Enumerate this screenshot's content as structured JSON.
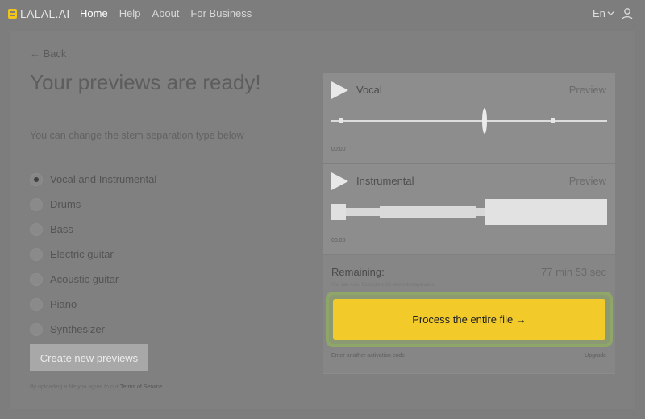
{
  "app": {
    "logo_text": "LALAL.AI"
  },
  "nav": {
    "items": [
      {
        "label": "Home",
        "active": true
      },
      {
        "label": "Help",
        "active": false
      },
      {
        "label": "About",
        "active": false
      },
      {
        "label": "For Business",
        "active": false
      }
    ],
    "language": "En"
  },
  "left": {
    "back_label": "← Back",
    "title": "Your previews are ready!",
    "subtitle": "You can change the stem separation type below",
    "options": [
      {
        "label": "Vocal and Instrumental",
        "checked": true
      },
      {
        "label": "Drums",
        "checked": false
      },
      {
        "label": "Bass",
        "checked": false
      },
      {
        "label": "Electric guitar",
        "checked": false
      },
      {
        "label": "Acoustic guitar",
        "checked": false
      },
      {
        "label": "Piano",
        "checked": false
      },
      {
        "label": "Synthesizer",
        "checked": false
      }
    ],
    "create_button": "Create new previews",
    "tos_prefix": "By uploading a file you agree to our",
    "tos_link": "Terms of Service"
  },
  "tracks": [
    {
      "name": "Vocal",
      "preview_label": "Preview",
      "time": "00:00"
    },
    {
      "name": "Instrumental",
      "preview_label": "Preview",
      "time": "00:00"
    }
  ],
  "remaining": {
    "label": "Remaining:",
    "value": "77 min 53 sec",
    "note": "You can now: Extraction: 80 seconds/separation",
    "process_button": "Process the entire file →",
    "activation_link": "Enter another activation code",
    "upgrade_link": "Upgrade"
  },
  "colors": {
    "accent": "#f2cb2b",
    "highlight_outline": "#8ea667"
  }
}
